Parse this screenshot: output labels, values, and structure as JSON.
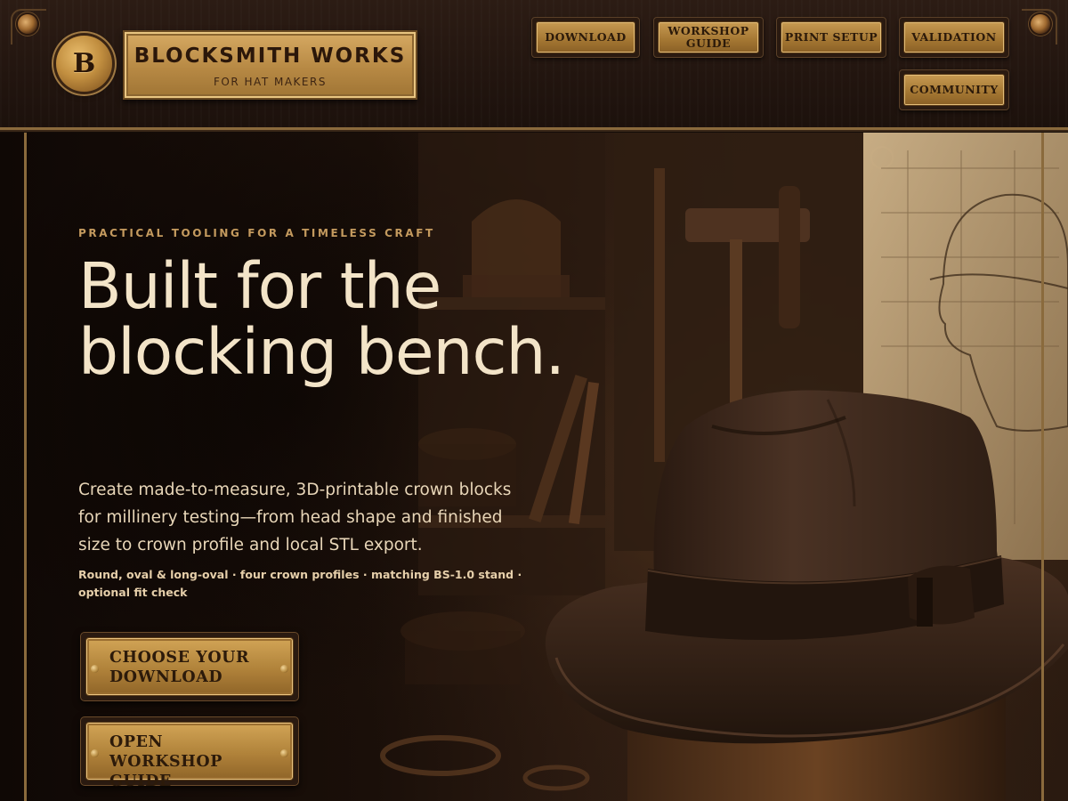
{
  "header": {
    "logo_letter": "B",
    "brand_name": "BLOCKSMITH WORKS",
    "brand_tagline": "FOR HAT MAKERS",
    "nav": [
      {
        "label": "DOWNLOAD"
      },
      {
        "label": "WORKSHOP GUIDE"
      },
      {
        "label": "PRINT SETUP"
      },
      {
        "label": "VALIDATION"
      },
      {
        "label": "COMMUNITY"
      }
    ]
  },
  "hero": {
    "eyebrow": "PRACTICAL TOOLING FOR A TIMELESS CRAFT",
    "headline": "Built for the blocking bench.",
    "lede": "Create made-to-measure, 3D-printable crown blocks for millinery testing—from head shape and finished size to crown profile and local STL export.",
    "features": "Round, oval & long-oval · four crown profiles · matching BS-1.0 stand · optional fit check",
    "cta_primary": "CHOOSE YOUR DOWNLOAD",
    "cta_secondary": "OPEN WORKSHOP GUIDE"
  },
  "icons": {
    "logo": "monogram-badge-icon",
    "rivet": "rivet-icon"
  },
  "colors": {
    "brass": "#c79a52",
    "dark_wood": "#22150f",
    "headline": "#f3e4c8",
    "accent_text": "#c49a5e"
  }
}
